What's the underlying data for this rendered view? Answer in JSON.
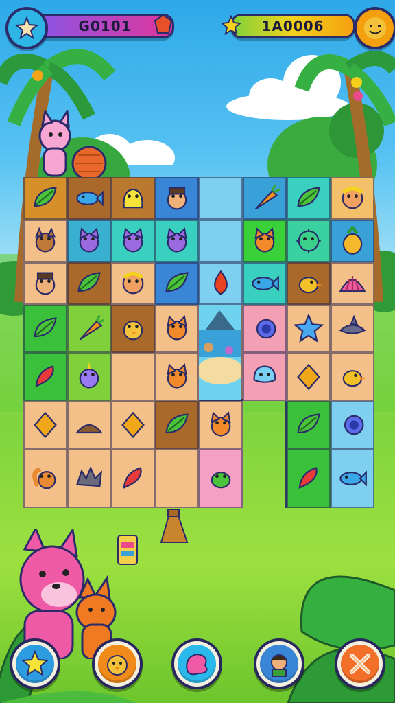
{
  "hud": {
    "score_left": "G0101",
    "score_right": "1A0006",
    "left_bar_color": "#e0369a",
    "right_bar_color": "#f4b20e"
  },
  "board": {
    "pieces": [
      "leaf",
      "fish",
      "blob",
      "hat-face",
      "empty",
      "carrot",
      "leaf",
      "face",
      "dog",
      "cat",
      "cat",
      "cat",
      "empty",
      "fox",
      "cactus",
      "pineapple",
      "hat-face",
      "leaf",
      "face",
      "leaf",
      "berry",
      "fish",
      "bird",
      "shell",
      "leaf",
      "carrot",
      "chick",
      "fox",
      "island",
      "snail",
      "star",
      "shark",
      "pepper",
      "unicorn",
      "empty",
      "fox",
      "island",
      "jelly",
      "gem",
      "bird",
      "gem",
      "hat",
      "gem",
      "leaf",
      "fox",
      "empty",
      "leaf",
      "snail",
      "squirrel",
      "hedgehog",
      "pepper",
      "empty",
      "beetle",
      "empty",
      "pepper",
      "fish"
    ]
  },
  "buttons": [
    {
      "name": "hint-button",
      "color": "#2e9ce0",
      "icon": "star-icon"
    },
    {
      "name": "chick-button",
      "color": "#f08a18",
      "icon": "chick-icon"
    },
    {
      "name": "shuffle-button",
      "color": "#2bb8ea",
      "icon": "blob-icon"
    },
    {
      "name": "character-button",
      "color": "#3a86d6",
      "icon": "character-icon"
    },
    {
      "name": "close-button",
      "color": "#f3702a",
      "icon": "close-icon"
    }
  ]
}
